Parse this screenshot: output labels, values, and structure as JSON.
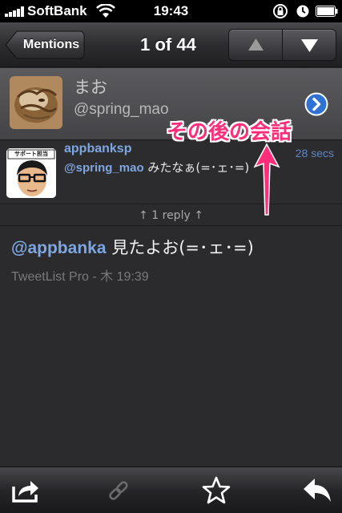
{
  "status_bar": {
    "carrier": "SoftBank",
    "time": "19:43",
    "icons": [
      "signal-bars-icon",
      "wifi-icon",
      "rotation-lock-icon",
      "alarm-icon",
      "battery-icon"
    ]
  },
  "nav": {
    "back_label": "Mentions",
    "title": "1 of 44",
    "prev_icon": "triangle-up-icon",
    "next_icon": "triangle-down-icon"
  },
  "conversation": {
    "name": "まお",
    "handle": "@spring_mao",
    "disclosure_icon": "chevron-right-circle-icon"
  },
  "reply_tweet": {
    "user": "appbanksp",
    "time": "28 secs",
    "mention": "@spring_mao",
    "text": " みたなぁ(=･ェ･=)",
    "avatar_caption": "サポート担当"
  },
  "replies_label": "↑ 1 reply ↑",
  "main_tweet": {
    "mention": "@appbanka",
    "text": " 見たよお(=･ェ･=)",
    "meta": "TweetList Pro - 木 19:39"
  },
  "annotation": {
    "text": "その後の会話",
    "color": "#ff2d7a"
  },
  "toolbar": {
    "icons": [
      "share-icon",
      "link-icon",
      "star-icon",
      "reply-icon"
    ]
  },
  "colors": {
    "accent_blue": "#7ea6e0",
    "background": "#2b2b2d"
  }
}
